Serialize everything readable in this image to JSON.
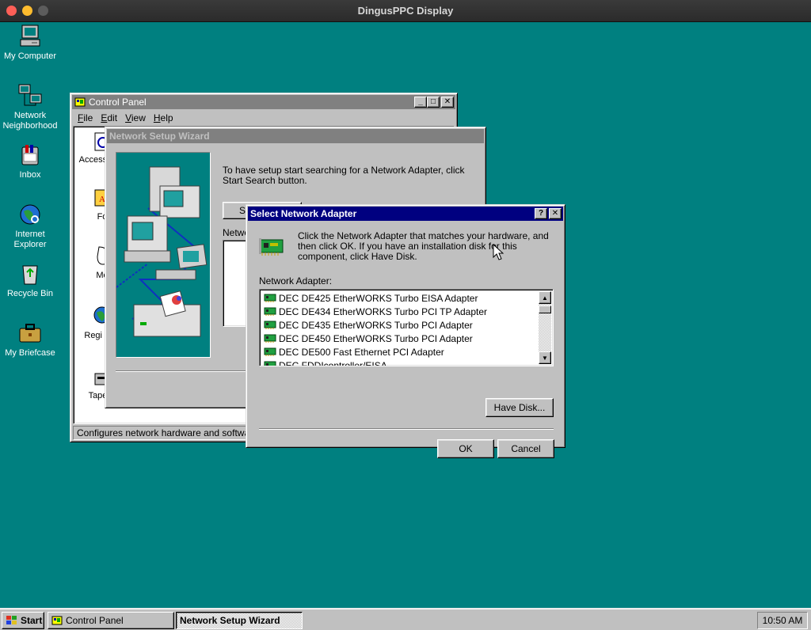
{
  "host": {
    "title": "DingusPPC Display"
  },
  "desktop_icons": [
    {
      "label": "My Computer"
    },
    {
      "label": "Network Neighborhood"
    },
    {
      "label": "Inbox"
    },
    {
      "label": "Internet Explorer"
    },
    {
      "label": "Recycle Bin"
    },
    {
      "label": "My Briefcase"
    }
  ],
  "control_panel": {
    "title": "Control Panel",
    "menu": [
      "File",
      "Edit",
      "View",
      "Help"
    ],
    "items": [
      "Access Opti",
      "Fo",
      "Mo",
      "Regi Sett",
      "Tape D"
    ],
    "status": "Configures network hardware and software"
  },
  "wizard": {
    "title": "Network Setup Wizard",
    "instruction": "To have setup start searching for a Network Adapter, click Start Search button.",
    "start_button_partial": "S",
    "list_label_partial": "Netwo"
  },
  "dialog": {
    "title": "Select Network Adapter",
    "help_btn": "?",
    "close_btn": "✕",
    "instruction": "Click the Network Adapter that matches your hardware, and then click OK.  If you have an installation disk for this component, click Have Disk.",
    "list_label": "Network Adapter:",
    "adapters": [
      "DEC DE425 EtherWORKS Turbo EISA Adapter",
      "DEC DE434 EtherWORKS Turbo PCI TP Adapter",
      "DEC DE435 EtherWORKS Turbo PCI Adapter",
      "DEC DE450 EtherWORKS Turbo PCI Adapter",
      "DEC DE500 Fast Ethernet PCI Adapter",
      "DEC FDDIcontroller/EISA"
    ],
    "have_disk": "Have Disk...",
    "ok": "OK",
    "cancel": "Cancel"
  },
  "taskbar": {
    "start": "Start",
    "tasks": [
      "Control Panel",
      "Network Setup Wizard"
    ],
    "clock": "10:50 AM"
  }
}
